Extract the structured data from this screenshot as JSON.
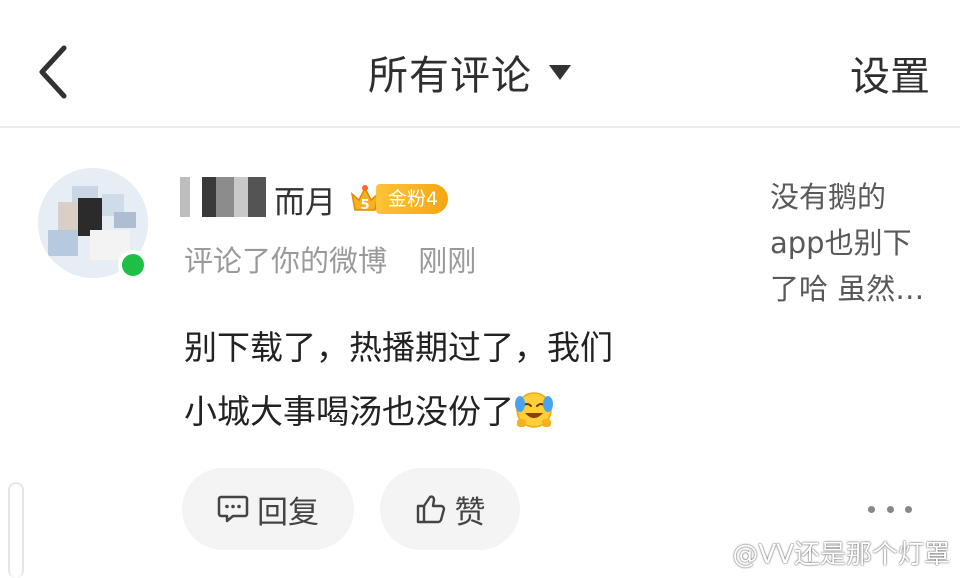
{
  "header": {
    "title": "所有评论",
    "settings_label": "设置"
  },
  "comment": {
    "username_suffix": "而月",
    "fan_level": "5",
    "fan_badge": "金粉4",
    "action": "评论了你的微博",
    "time": "刚刚",
    "text_line1": "别下载了，热播期过了，我们",
    "text_line2": "小城大事喝汤也没份了",
    "original_snippet": "没有鹅的app也别下了哈 虽然…",
    "reply_label": "回复",
    "like_label": "赞"
  },
  "watermark": {
    "text": "@VV还是那个灯罩"
  },
  "colors": {
    "online": "#1fbe45",
    "badge": "#f4a70f",
    "meta": "#9a9a9a",
    "pill_bg": "#f4f4f4"
  },
  "icons": [
    "back-arrow-icon",
    "caret-down-icon",
    "fan-crown-icon",
    "comment-icon",
    "thumbs-up-icon",
    "more-icon",
    "cry-laugh-emoji",
    "weibo-logo-icon"
  ]
}
